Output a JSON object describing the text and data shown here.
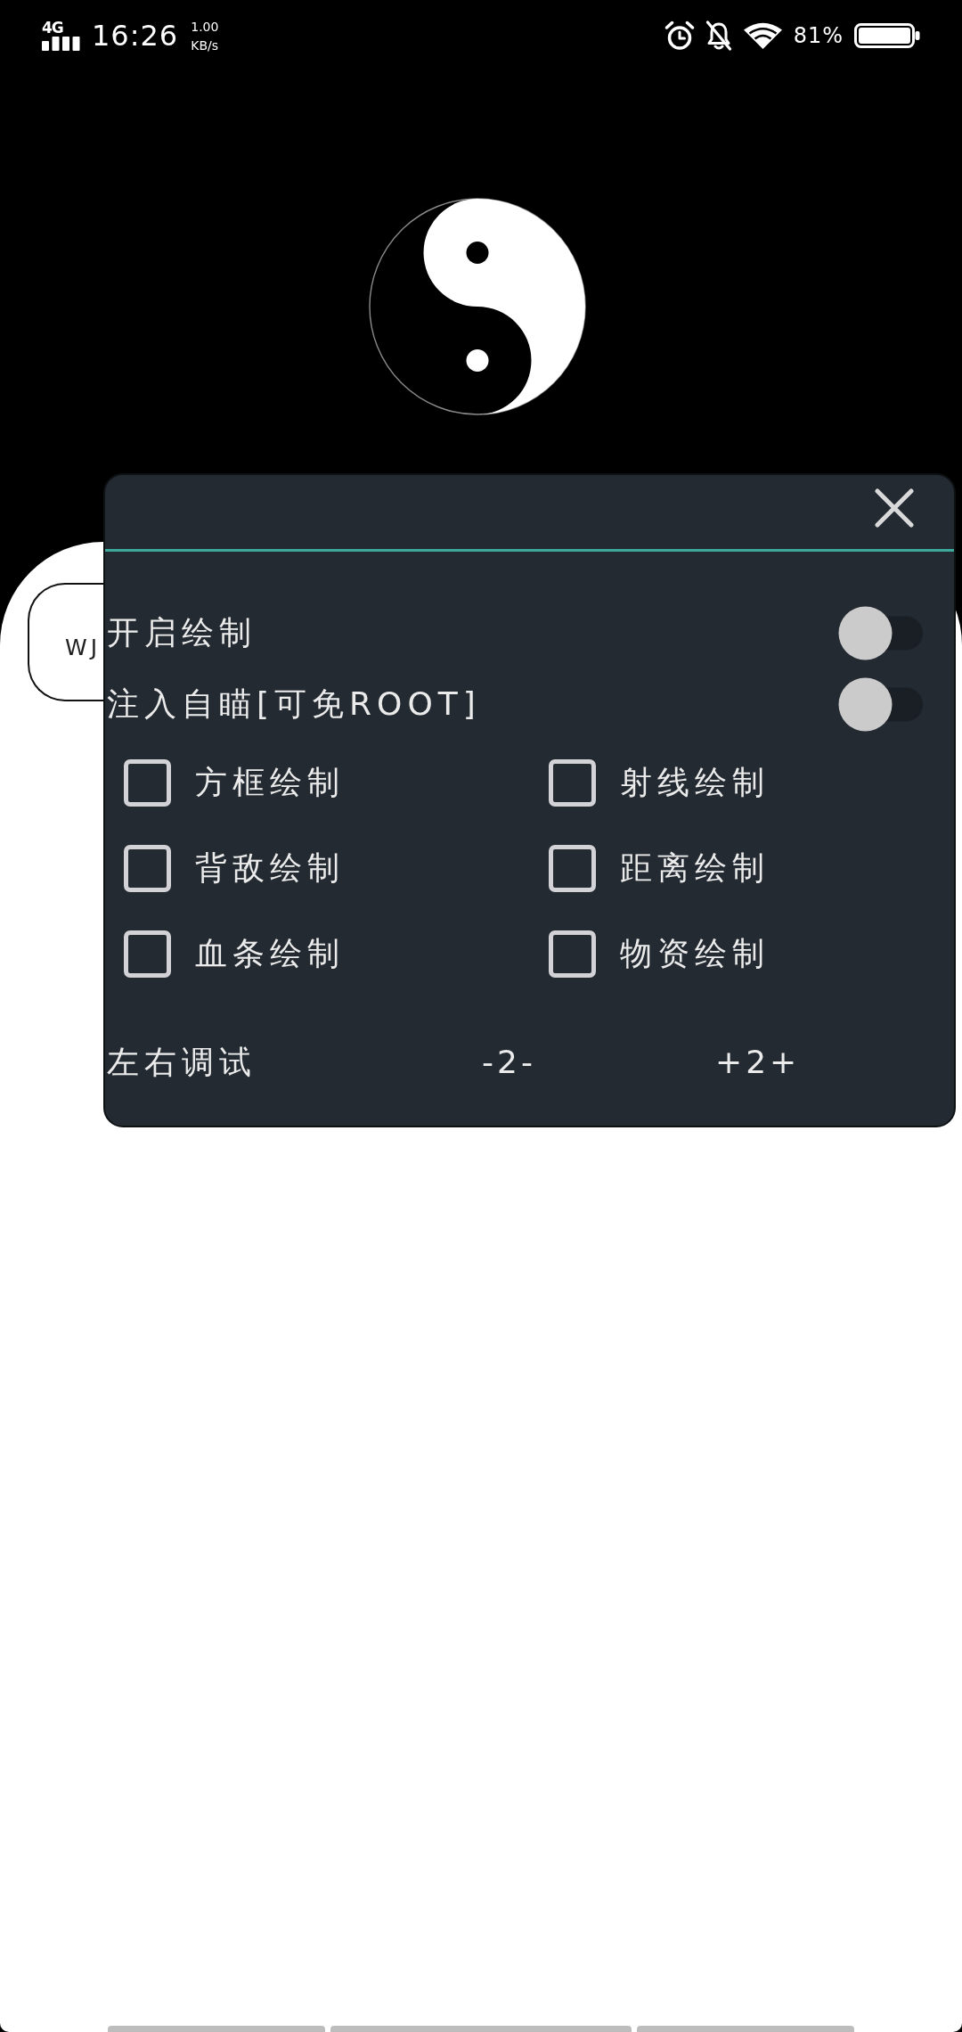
{
  "status_bar": {
    "network": "4G",
    "time": "16:26",
    "speed_value": "1.00",
    "speed_unit": "KB/s",
    "battery": "81%"
  },
  "background_card": {
    "text": "WJ"
  },
  "panel": {
    "switches": [
      {
        "label": "开启绘制",
        "on": false
      },
      {
        "label": "注入自瞄[可免ROOT]",
        "on": false
      }
    ],
    "checkboxes": [
      {
        "label": "方框绘制",
        "checked": false
      },
      {
        "label": "射线绘制",
        "checked": false
      },
      {
        "label": "背敌绘制",
        "checked": false
      },
      {
        "label": "距离绘制",
        "checked": false
      },
      {
        "label": "血条绘制",
        "checked": false
      },
      {
        "label": "物资绘制",
        "checked": false
      }
    ],
    "adjust": {
      "label": "左右调试",
      "decrease": "-2-",
      "increase": "+2+"
    }
  }
}
